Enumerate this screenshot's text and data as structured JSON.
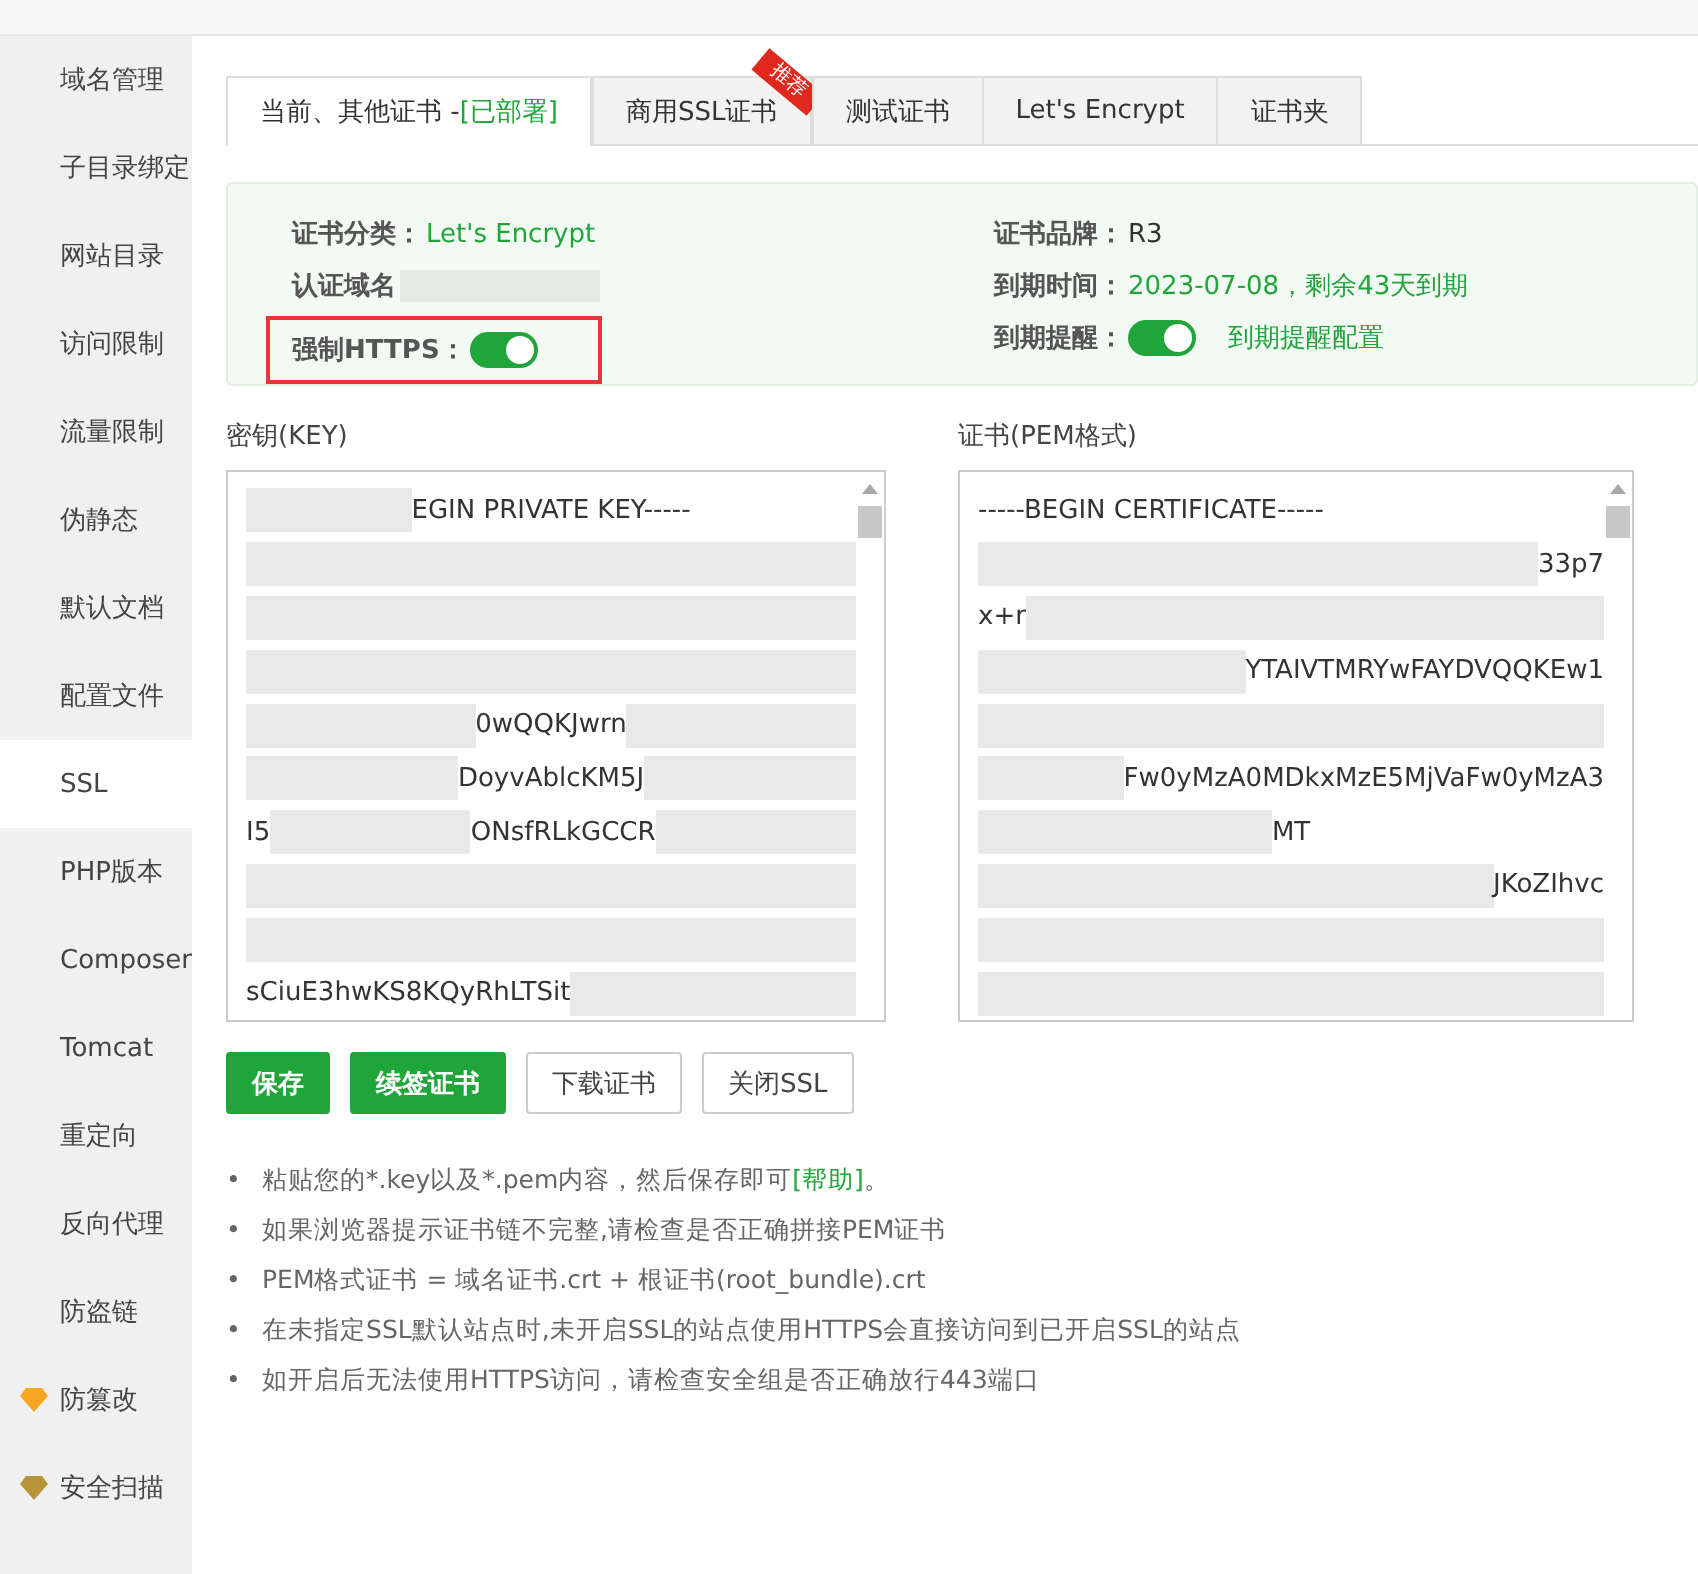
{
  "sidebar": {
    "items": [
      {
        "label": "域名管理",
        "selected": false,
        "kind": "plain"
      },
      {
        "label": "子目录绑定",
        "selected": false,
        "kind": "plain"
      },
      {
        "label": "网站目录",
        "selected": false,
        "kind": "plain"
      },
      {
        "label": "访问限制",
        "selected": false,
        "kind": "plain"
      },
      {
        "label": "流量限制",
        "selected": false,
        "kind": "plain"
      },
      {
        "label": "伪静态",
        "selected": false,
        "kind": "plain"
      },
      {
        "label": "默认文档",
        "selected": false,
        "kind": "plain"
      },
      {
        "label": "配置文件",
        "selected": false,
        "kind": "plain"
      },
      {
        "label": "SSL",
        "selected": true,
        "kind": "plain"
      },
      {
        "label": "PHP版本",
        "selected": false,
        "kind": "plain"
      },
      {
        "label": "Composer",
        "selected": false,
        "kind": "plain"
      },
      {
        "label": "Tomcat",
        "selected": false,
        "kind": "plain"
      },
      {
        "label": "重定向",
        "selected": false,
        "kind": "plain"
      },
      {
        "label": "反向代理",
        "selected": false,
        "kind": "plain"
      },
      {
        "label": "防盗链",
        "selected": false,
        "kind": "plain"
      },
      {
        "label": "防篡改",
        "selected": false,
        "kind": "premium",
        "color": "#f5a623"
      },
      {
        "label": "安全扫描",
        "selected": false,
        "kind": "premium",
        "color": "#b8943a"
      }
    ]
  },
  "tabs": [
    {
      "label": "当前、其他证书 - ",
      "suffix": "[已部署]",
      "selected": true
    },
    {
      "label": "商用SSL证书",
      "badge": "推荐",
      "selected": false
    },
    {
      "label": "测试证书",
      "selected": false
    },
    {
      "label": "Let's Encrypt",
      "selected": false
    },
    {
      "label": "证书夹",
      "selected": false
    }
  ],
  "info": {
    "left": [
      {
        "kind": "text",
        "label": "证书分类：",
        "value": "Let's Encrypt",
        "accent": true,
        "highlighted": false
      },
      {
        "kind": "blurred",
        "label": "认证域名",
        "highlighted": false
      },
      {
        "kind": "toggle",
        "label": "强制HTTPS：",
        "on": true,
        "highlighted": true
      }
    ],
    "right": [
      {
        "kind": "text",
        "label": "证书品牌：",
        "value": "R3",
        "accent": false,
        "highlighted": false
      },
      {
        "kind": "text",
        "label": "到期时间：",
        "value": "2023-07-08，剩余43天到期",
        "accent": true,
        "highlighted": false
      },
      {
        "kind": "toggle",
        "label": "到期提醒：",
        "on": true,
        "link": "到期提醒配置",
        "highlighted": false
      }
    ]
  },
  "key_box": {
    "label": "密钥(KEY)",
    "lines": [
      [
        {
          "kind": "blur"
        },
        {
          "kind": "text",
          "text": "EGIN PRIVATE KEY-----"
        },
        {
          "kind": "gap"
        }
      ],
      [
        {
          "kind": "blur"
        }
      ],
      [
        {
          "kind": "blur"
        }
      ],
      [
        {
          "kind": "blur"
        }
      ],
      [
        {
          "kind": "blur"
        },
        {
          "kind": "text",
          "text": "0wQQKJwrn"
        },
        {
          "kind": "blur"
        }
      ],
      [
        {
          "kind": "blur"
        },
        {
          "kind": "text",
          "text": "DoyvAblcKM5J"
        },
        {
          "kind": "blur"
        }
      ],
      [
        {
          "kind": "text",
          "text": "I5"
        },
        {
          "kind": "blur"
        },
        {
          "kind": "text",
          "text": "ONsfRLkGCCR"
        },
        {
          "kind": "blur"
        }
      ],
      [
        {
          "kind": "blur"
        }
      ],
      [
        {
          "kind": "blur"
        }
      ],
      [
        {
          "kind": "text",
          "text": "sCiuE3hwKS8KQyRhLTSit"
        },
        {
          "kind": "blur"
        }
      ]
    ]
  },
  "cert_box": {
    "label": "证书(PEM格式)",
    "lines": [
      [
        {
          "kind": "text",
          "text": "-----BEGIN CERTIFICATE-----"
        },
        {
          "kind": "gap"
        }
      ],
      [
        {
          "kind": "blur"
        },
        {
          "kind": "text",
          "text": "33p7"
        }
      ],
      [
        {
          "kind": "text",
          "text": "x+r"
        },
        {
          "kind": "blur"
        }
      ],
      [
        {
          "kind": "blur"
        },
        {
          "kind": "text",
          "text": "YTAIVTMRYwFAYDVQQKEw1"
        }
      ],
      [
        {
          "kind": "blur"
        }
      ],
      [
        {
          "kind": "blur"
        },
        {
          "kind": "text",
          "text": "Fw0yMzA0MDkxMzE5MjVaFw0yMzA3"
        }
      ],
      [
        {
          "kind": "blur"
        },
        {
          "kind": "text",
          "text": "MT"
        },
        {
          "kind": "gap"
        }
      ],
      [
        {
          "kind": "blur"
        },
        {
          "kind": "text",
          "text": "JKoZIhvc"
        }
      ],
      [
        {
          "kind": "blur"
        }
      ],
      [
        {
          "kind": "blur"
        }
      ]
    ]
  },
  "buttons": [
    {
      "label": "保存",
      "kind": "primary"
    },
    {
      "label": "续签证书",
      "kind": "primary"
    },
    {
      "label": "下载证书",
      "kind": "outline"
    },
    {
      "label": "关闭SSL",
      "kind": "outline"
    }
  ],
  "notes": [
    {
      "bullet": "•",
      "parts": [
        {
          "kind": "plain",
          "text": "粘贴您的*.key以及*.pem内容，然后保存即可"
        },
        {
          "kind": "link",
          "text": "[帮助]"
        },
        {
          "kind": "plain",
          "text": "。"
        }
      ]
    },
    {
      "bullet": "•",
      "parts": [
        {
          "kind": "plain",
          "text": "如果浏览器提示证书链不完整,请检查是否正确拼接PEM证书"
        }
      ]
    },
    {
      "bullet": "•",
      "parts": [
        {
          "kind": "plain",
          "text": "PEM格式证书 = 域名证书.crt + 根证书(root_bundle).crt"
        }
      ]
    },
    {
      "bullet": "•",
      "parts": [
        {
          "kind": "plain",
          "text": "在未指定SSL默认站点时,未开启SSL的站点使用HTTPS会直接访问到已开启SSL的站点"
        }
      ]
    },
    {
      "bullet": "•",
      "parts": [
        {
          "kind": "plain",
          "text": "如开启后无法使用HTTPS访问，请检查安全组是否正确放行443端口"
        }
      ]
    }
  ]
}
